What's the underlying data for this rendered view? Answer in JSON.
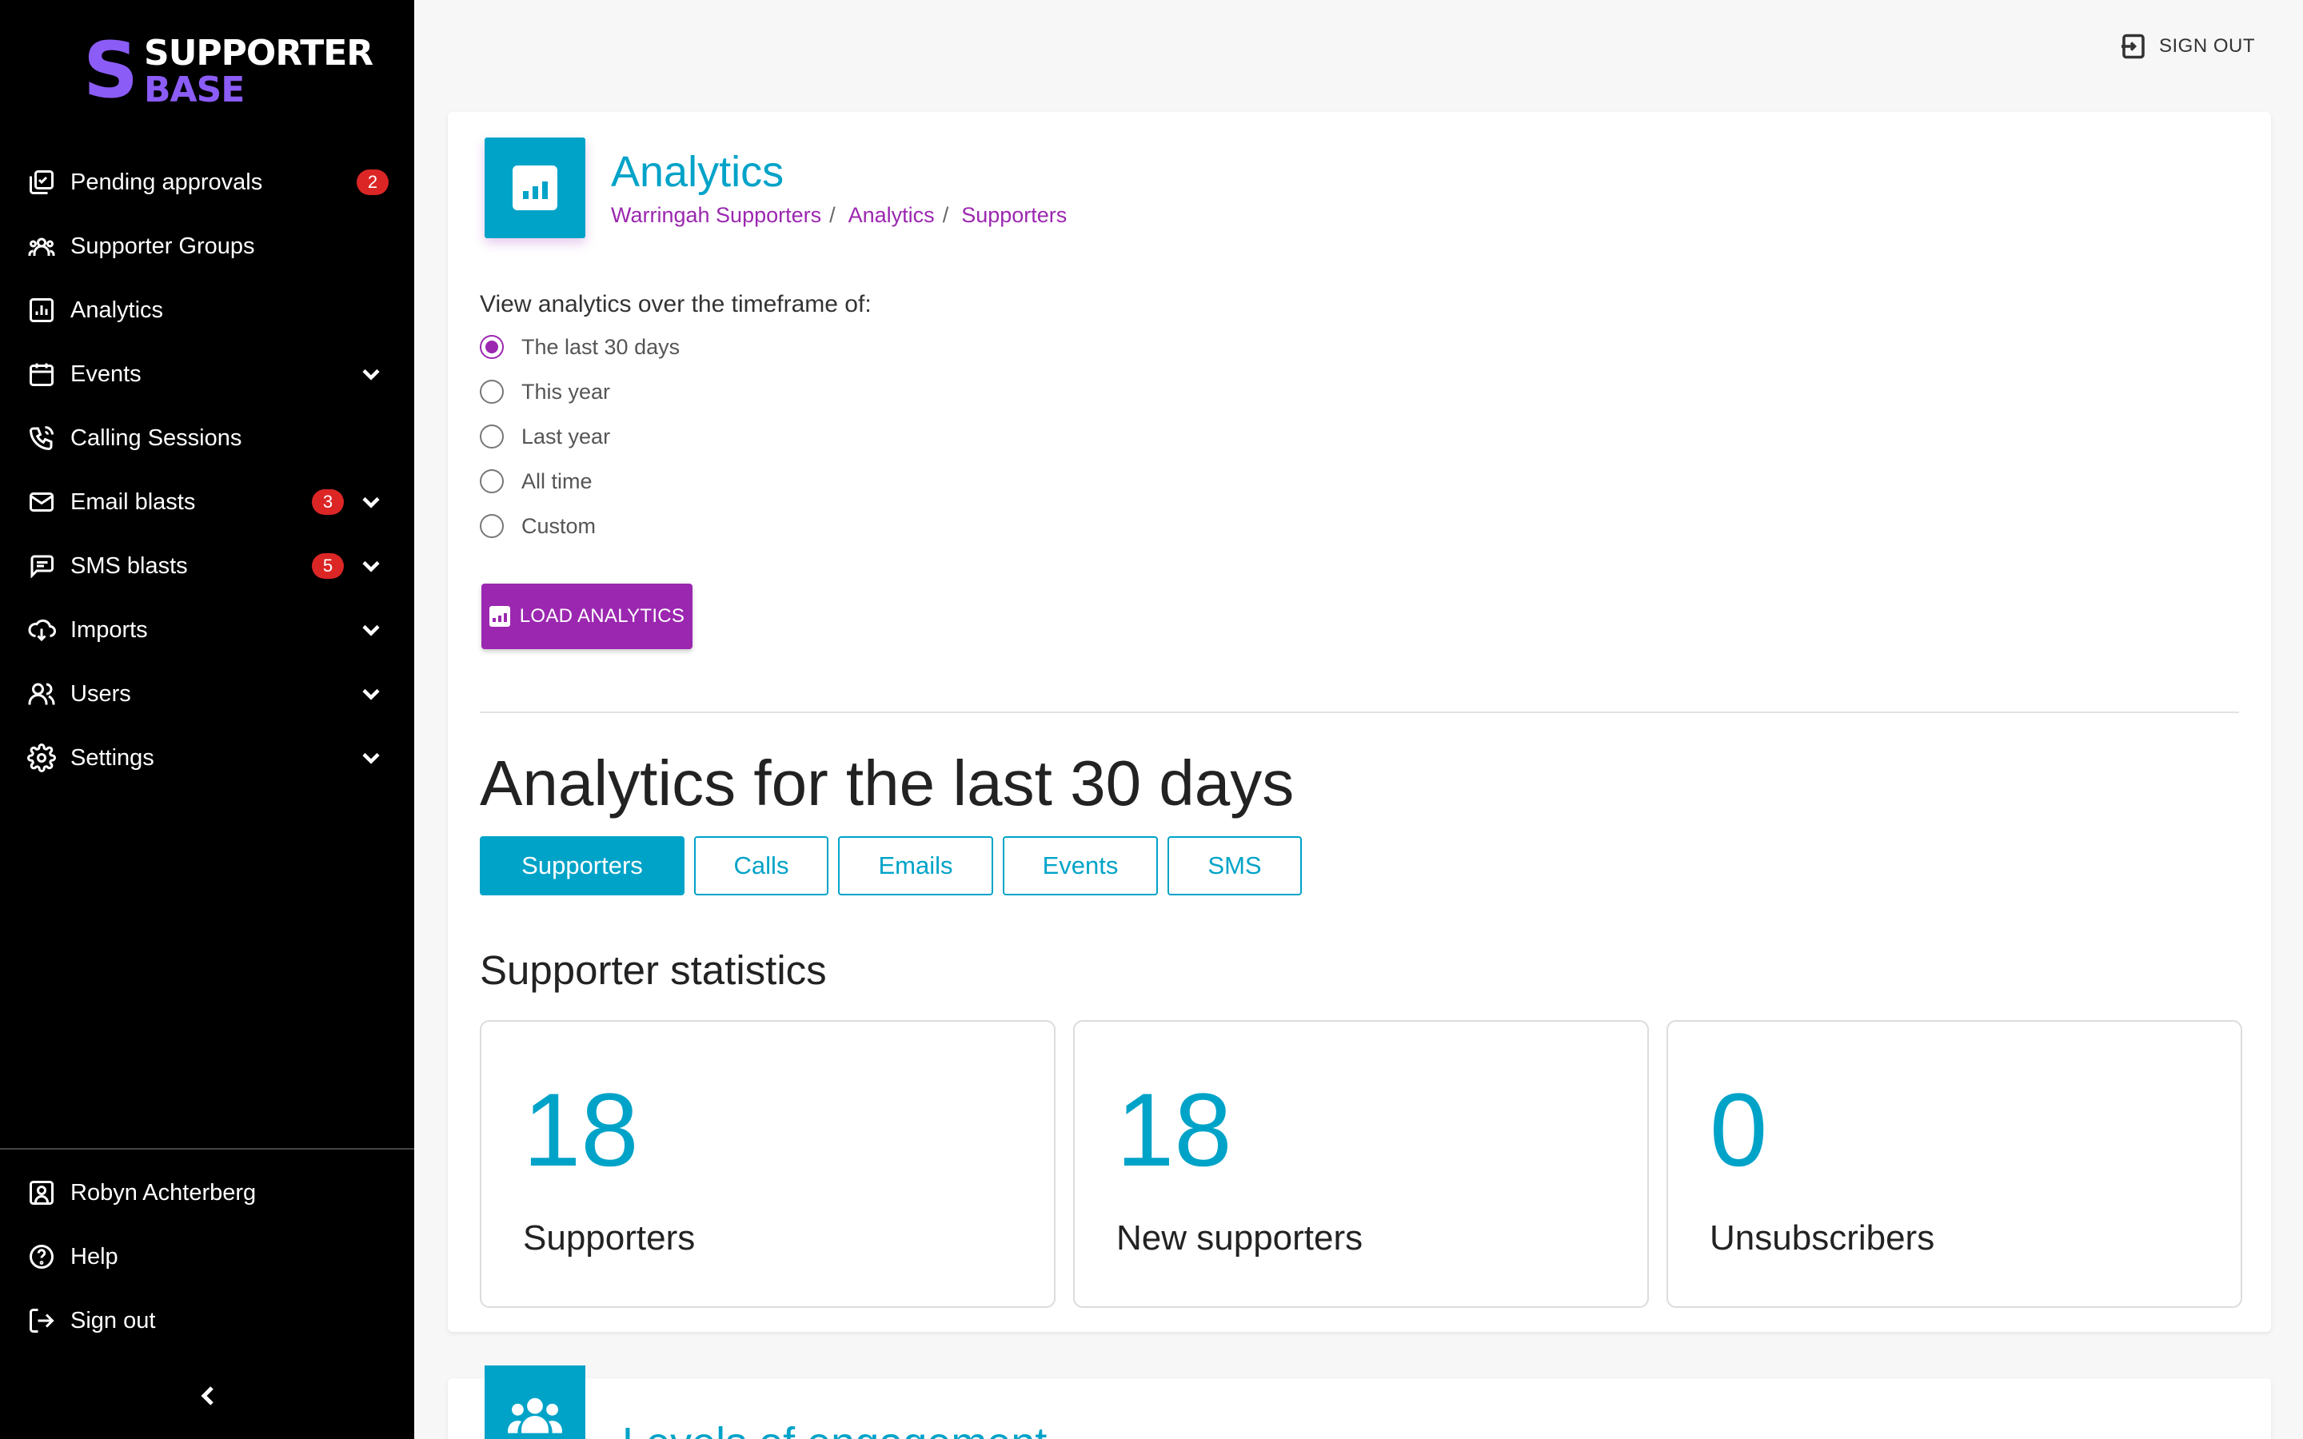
{
  "brand": {
    "line1": "SUPPORTER",
    "line2": "BASE",
    "accent": "#8b5cf6"
  },
  "colors": {
    "primary": "#00a3c8",
    "secondary": "#9b27b0",
    "badge": "#dc2626",
    "sidebar_bg": "#000000"
  },
  "sidebar": {
    "items": [
      {
        "label": "Pending approvals",
        "icon": "approvals-icon",
        "badge": "2",
        "expandable": false
      },
      {
        "label": "Supporter Groups",
        "icon": "groups-icon",
        "badge": null,
        "expandable": false
      },
      {
        "label": "Analytics",
        "icon": "analytics-icon",
        "badge": null,
        "expandable": false
      },
      {
        "label": "Events",
        "icon": "calendar-icon",
        "badge": null,
        "expandable": true
      },
      {
        "label": "Calling Sessions",
        "icon": "phone-icon",
        "badge": null,
        "expandable": false
      },
      {
        "label": "Email blasts",
        "icon": "mail-icon",
        "badge": "3",
        "expandable": true
      },
      {
        "label": "SMS blasts",
        "icon": "chat-icon",
        "badge": "5",
        "expandable": true
      },
      {
        "label": "Imports",
        "icon": "cloud-download-icon",
        "badge": null,
        "expandable": true
      },
      {
        "label": "Users",
        "icon": "users-icon",
        "badge": null,
        "expandable": true
      },
      {
        "label": "Settings",
        "icon": "gear-icon",
        "badge": null,
        "expandable": true
      }
    ],
    "bottom": [
      {
        "label": "Robyn Achterberg",
        "icon": "user-card-icon"
      },
      {
        "label": "Help",
        "icon": "help-icon"
      },
      {
        "label": "Sign out",
        "icon": "sign-out-icon"
      }
    ]
  },
  "header": {
    "signout_label": "SIGN OUT"
  },
  "page": {
    "title": "Analytics",
    "breadcrumb": [
      "Warringah Supporters",
      "Analytics",
      "Supporters"
    ],
    "timeframe_label": "View analytics over the timeframe of:",
    "timeframe_options": [
      "The last 30 days",
      "This year",
      "Last year",
      "All time",
      "Custom"
    ],
    "timeframe_selected": "The last 30 days",
    "load_button": "LOAD ANALYTICS",
    "analytics_heading": "Analytics for the last 30 days",
    "tabs": [
      "Supporters",
      "Calls",
      "Emails",
      "Events",
      "SMS"
    ],
    "active_tab": "Supporters",
    "section_title": "Supporter statistics",
    "stats": [
      {
        "value": "18",
        "label": "Supporters"
      },
      {
        "value": "18",
        "label": "New supporters"
      },
      {
        "value": "0",
        "label": "Unsubscribers"
      }
    ]
  },
  "next_card": {
    "title": "Levels of engagement"
  }
}
